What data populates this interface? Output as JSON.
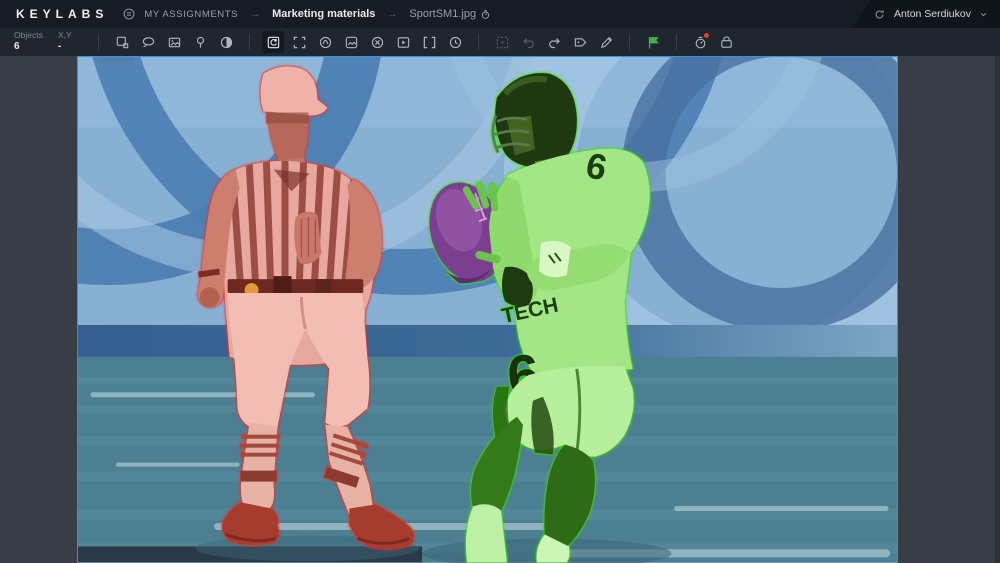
{
  "app": {
    "brand": "KEYLABS",
    "accent_color": "#43b14b"
  },
  "header": {
    "breadcrumb": {
      "root": "MY ASSIGNMENTS",
      "separator": "→",
      "project": "Marketing materials",
      "file": "SportSM1.jpg"
    },
    "user": {
      "name": "Anton Serdiukov"
    }
  },
  "toolbar": {
    "stats": {
      "objects_label": "Objects",
      "objects_value": "6",
      "xy_label": "X,Y",
      "xy_value": "-"
    },
    "tools": [
      {
        "name": "shape-tool",
        "state": "normal"
      },
      {
        "name": "lasso-tool",
        "state": "normal"
      },
      {
        "name": "frame-tool",
        "state": "normal"
      },
      {
        "name": "pin-tool",
        "state": "normal"
      },
      {
        "name": "contrast-tool",
        "state": "normal"
      },
      {
        "name": "transform-tool",
        "state": "selected"
      },
      {
        "name": "fit-screen-tool",
        "state": "normal"
      },
      {
        "name": "smart-select-tool",
        "state": "normal"
      },
      {
        "name": "image-tool",
        "state": "normal"
      },
      {
        "name": "octagon-tool",
        "state": "normal"
      },
      {
        "name": "media-tool",
        "state": "normal"
      },
      {
        "name": "brackets-tool",
        "state": "normal"
      },
      {
        "name": "history-tool",
        "state": "normal"
      },
      {
        "name": "region-select-tool",
        "state": "disabled"
      },
      {
        "name": "undo",
        "state": "disabled"
      },
      {
        "name": "redo",
        "state": "normal"
      },
      {
        "name": "label-tool",
        "state": "normal"
      },
      {
        "name": "pen-tool",
        "state": "normal"
      },
      {
        "name": "flag-tool",
        "state": "accent"
      },
      {
        "name": "status-indicator",
        "state": "badged"
      },
      {
        "name": "toolbox",
        "state": "normal"
      }
    ]
  },
  "canvas": {
    "file": "SportSM1.jpg",
    "jersey_text": "TECH",
    "jersey_number": "6",
    "masks": [
      {
        "object": "referee",
        "overlay_color": "#f03022"
      },
      {
        "object": "football-player",
        "overlay_color": "#3ae10c"
      },
      {
        "object": "football",
        "overlay_color": "#8e3f9e"
      }
    ]
  }
}
